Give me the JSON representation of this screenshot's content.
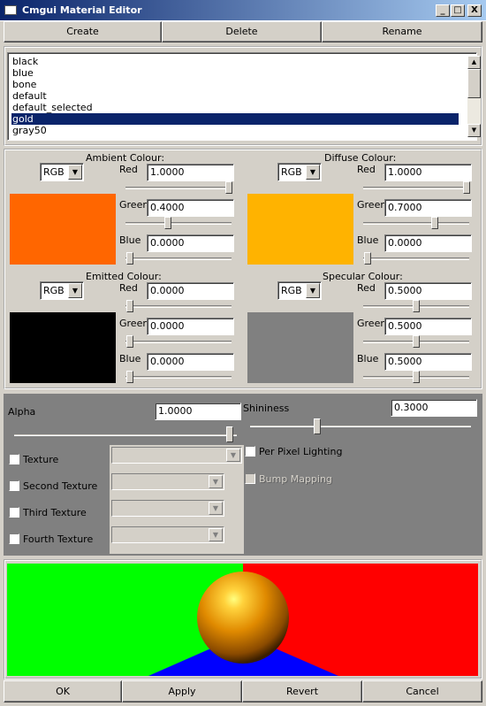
{
  "window": {
    "title": "Cmgui Material Editor",
    "minimize": "_",
    "maximize": "□",
    "close": "X"
  },
  "toolbar": {
    "create": "Create",
    "delete": "Delete",
    "rename": "Rename"
  },
  "materials": {
    "items": [
      "black",
      "blue",
      "bone",
      "default",
      "default_selected",
      "gold",
      "gray50"
    ],
    "selected": "gold"
  },
  "ambient": {
    "title": "Ambient Colour:",
    "mode": "RGB",
    "red": "1.0000",
    "green": "0.4000",
    "blue": "0.0000",
    "swatch": "#ff6600"
  },
  "diffuse": {
    "title": "Diffuse Colour:",
    "mode": "RGB",
    "red": "1.0000",
    "green": "0.7000",
    "blue": "0.0000",
    "swatch": "#ffb300"
  },
  "emitted": {
    "title": "Emitted Colour:",
    "mode": "RGB",
    "red": "0.0000",
    "green": "0.0000",
    "blue": "0.0000",
    "swatch": "#000000"
  },
  "specular": {
    "title": "Specular Colour:",
    "mode": "RGB",
    "red": "0.5000",
    "green": "0.5000",
    "blue": "0.5000",
    "swatch": "#808080"
  },
  "labels": {
    "red": "Red",
    "green": "Green",
    "blue": "Blue"
  },
  "alpha": {
    "label": "Alpha",
    "value": "1.0000"
  },
  "shininess": {
    "label": "Shininess",
    "value": "0.3000"
  },
  "textures": {
    "texture": "Texture",
    "second": "Second Texture",
    "third": "Third Texture",
    "fourth": "Fourth Texture"
  },
  "options": {
    "per_pixel": "Per Pixel Lighting",
    "bump": "Bump Mapping"
  },
  "buttons": {
    "ok": "OK",
    "apply": "Apply",
    "revert": "Revert",
    "cancel": "Cancel"
  },
  "colors": {
    "title_bar": "#0a246a",
    "selection": "#0a246a",
    "preview_left": "#00ff00",
    "preview_right": "#ff0000",
    "preview_floor": "#0000ff",
    "sphere": "#ffa500"
  }
}
